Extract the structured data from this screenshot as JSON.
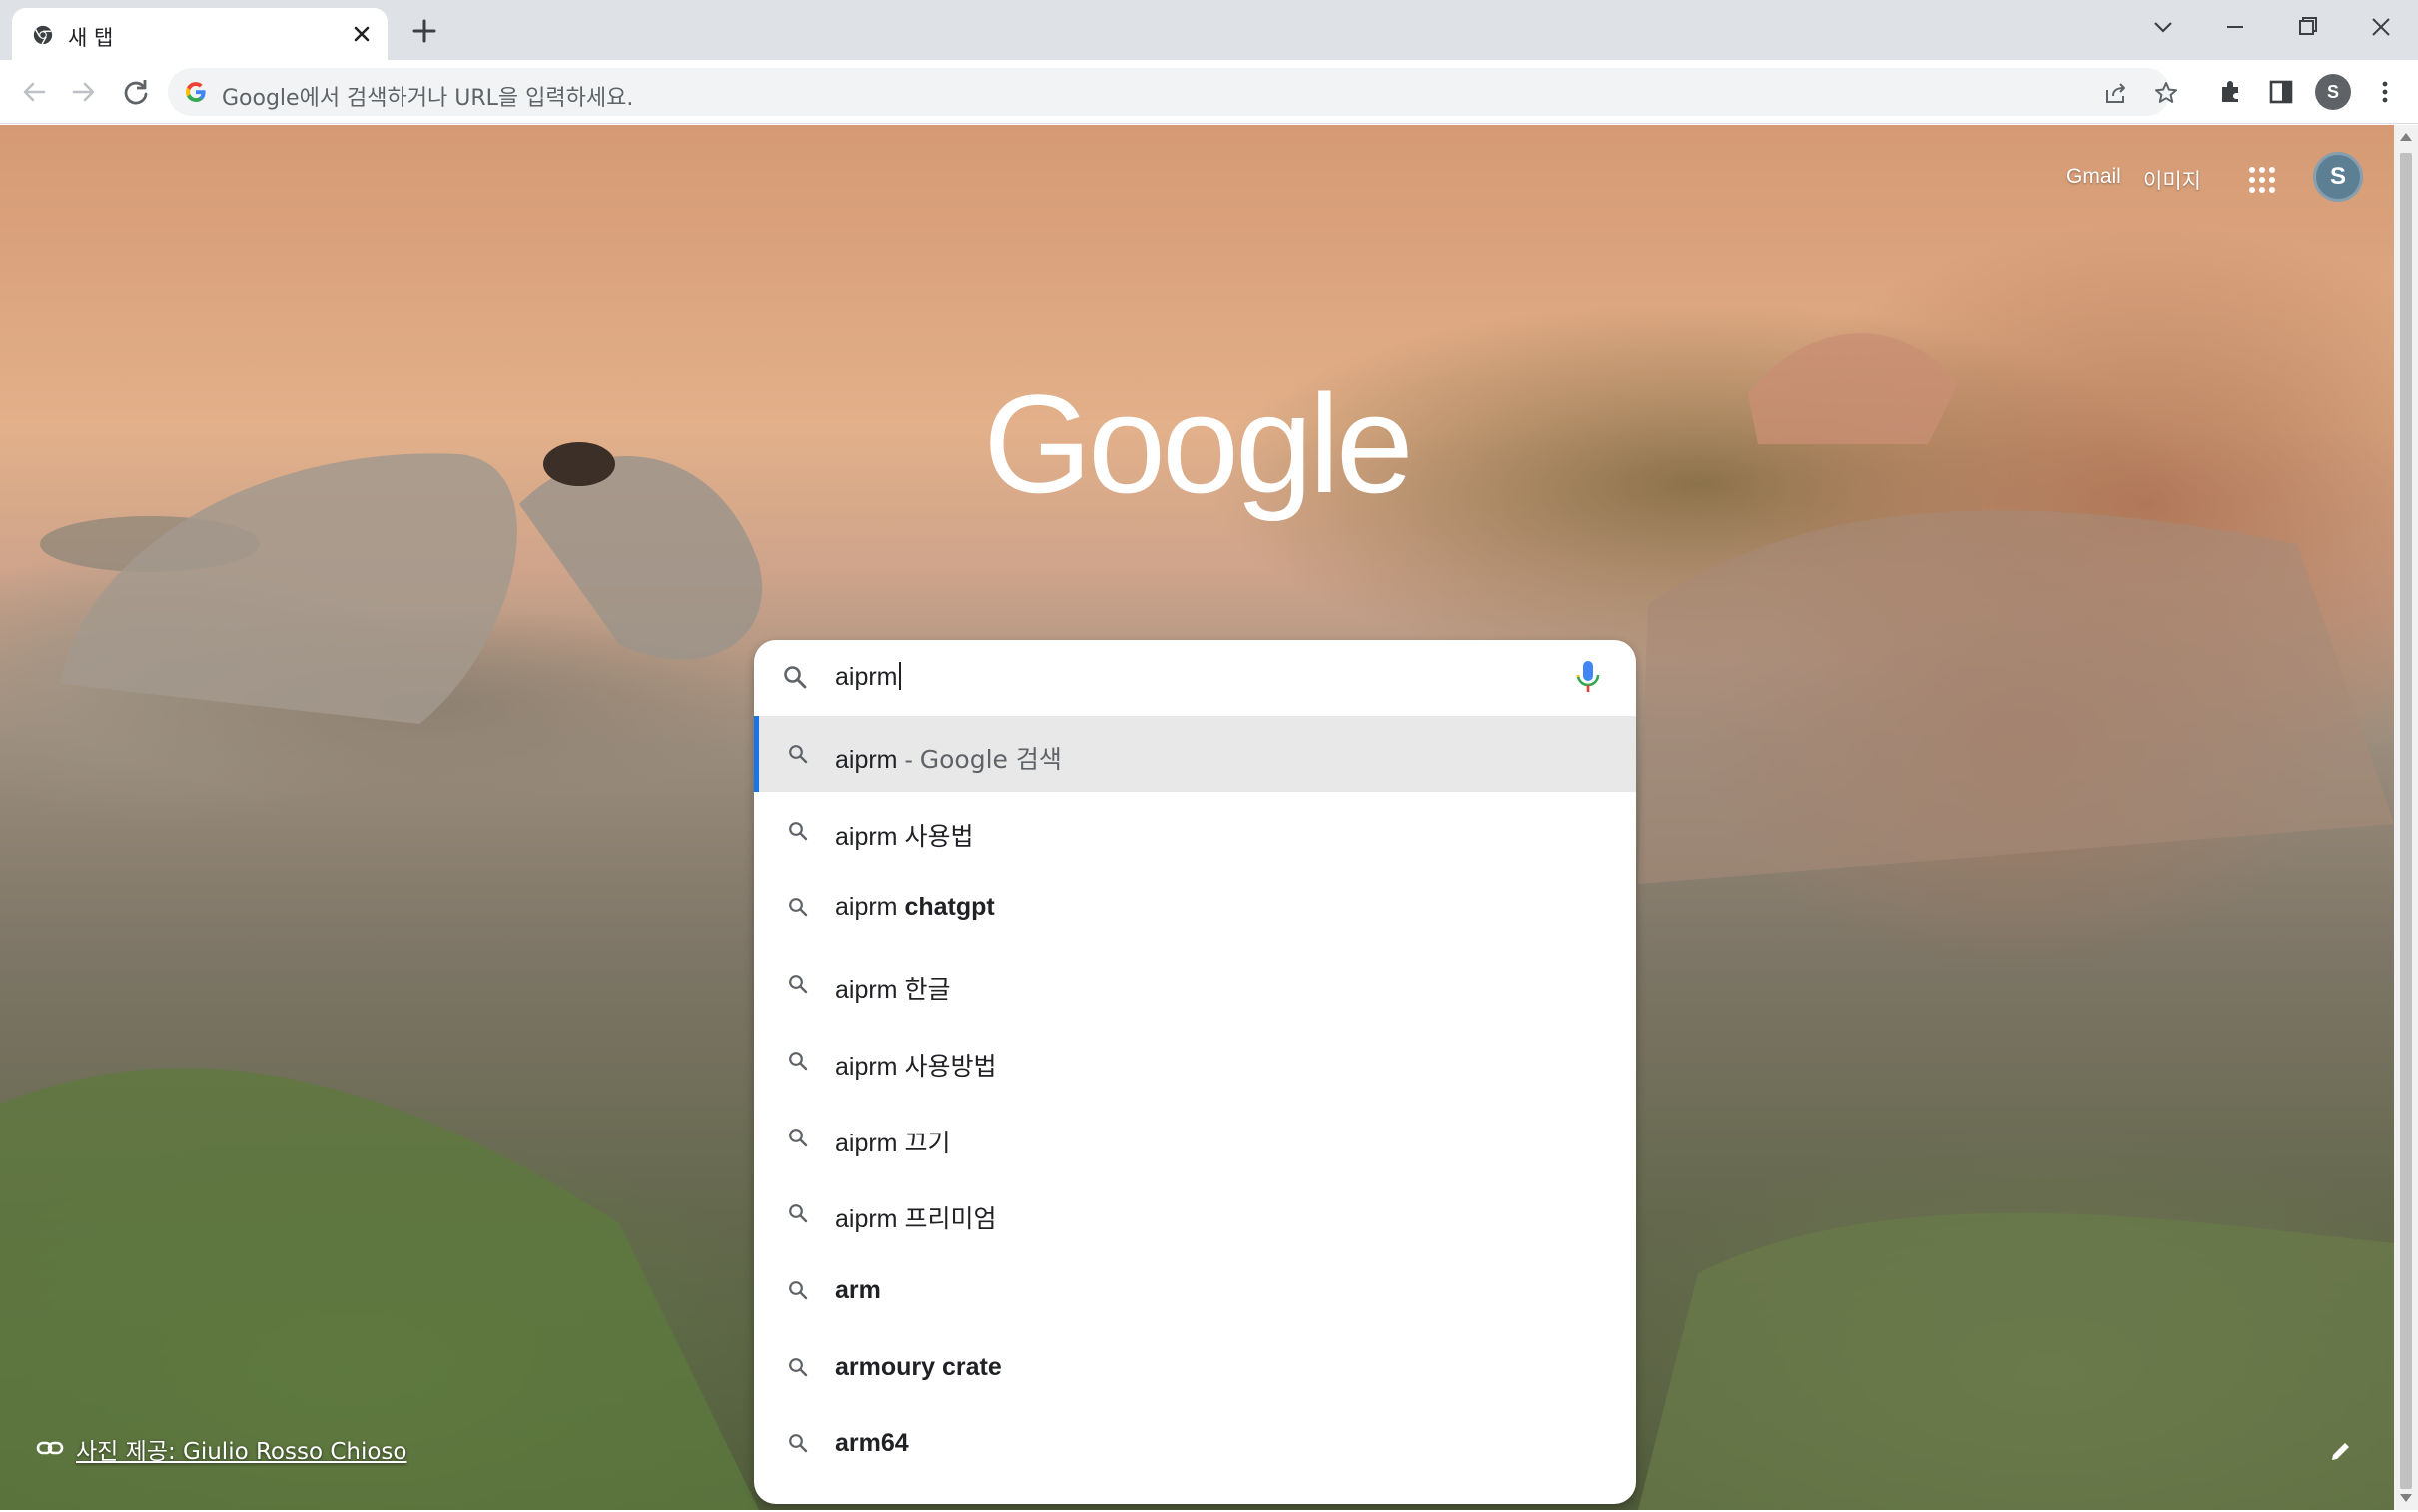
{
  "tab": {
    "title": "새 탭"
  },
  "omnibox": {
    "placeholder": "Google에서 검색하거나 URL을 입력하세요."
  },
  "header": {
    "gmail": "Gmail",
    "images": "이미지",
    "profile_initial": "S"
  },
  "toolbar": {
    "profile_initial": "S"
  },
  "search": {
    "query": "aiprm",
    "suggestions": [
      {
        "prefix": "aiprm",
        "rest": "",
        "suffix": "Google 검색",
        "separator": " - ",
        "bold_rest": false
      },
      {
        "prefix": "aiprm ",
        "rest": "사용법",
        "suffix": "",
        "separator": "",
        "bold_rest": false
      },
      {
        "prefix": "aiprm ",
        "rest": "chatgpt",
        "suffix": "",
        "separator": "",
        "bold_rest": true
      },
      {
        "prefix": "aiprm ",
        "rest": "한글",
        "suffix": "",
        "separator": "",
        "bold_rest": false
      },
      {
        "prefix": "aiprm ",
        "rest": "사용방법",
        "suffix": "",
        "separator": "",
        "bold_rest": false
      },
      {
        "prefix": "aiprm ",
        "rest": "끄기",
        "suffix": "",
        "separator": "",
        "bold_rest": false
      },
      {
        "prefix": "aiprm ",
        "rest": "프리미엄",
        "suffix": "",
        "separator": "",
        "bold_rest": false
      },
      {
        "prefix": "",
        "rest": "arm",
        "suffix": "",
        "separator": "",
        "bold_rest": true
      },
      {
        "prefix": "",
        "rest": "armoury crate",
        "suffix": "",
        "separator": "",
        "bold_rest": true
      },
      {
        "prefix": "",
        "rest": "arm64",
        "suffix": "",
        "separator": "",
        "bold_rest": true
      }
    ]
  },
  "attribution": {
    "text": "사진 제공: Giulio Rosso Chioso"
  },
  "colors": {
    "accent": "#1a73e8",
    "mic_blue": "#4285f4",
    "mic_red": "#ea4335",
    "mic_yellow": "#fbbc04",
    "mic_green": "#34a853"
  }
}
